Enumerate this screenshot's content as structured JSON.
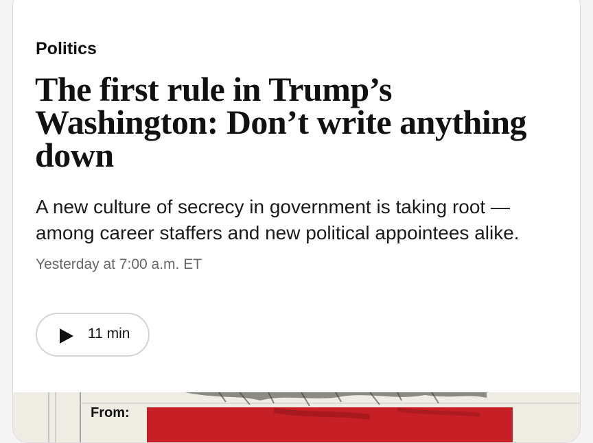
{
  "article": {
    "section": "Politics",
    "headline": "The first rule in Trump’s Washington: Don’t write anything down",
    "dek": "A new culture of secrecy in government is taking root — among career staffers and new political appointees alike.",
    "timestamp": "Yesterday at 7:00 a.m. ET",
    "listen": {
      "icon": "play-icon",
      "duration": "11 min"
    },
    "image": {
      "memo_label": "From:",
      "redaction_color": "#c62026"
    }
  }
}
